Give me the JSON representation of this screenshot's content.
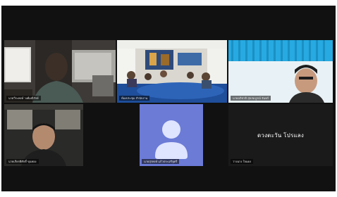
{
  "meeting": {
    "participants": [
      {
        "id": "p1",
        "name": "นายวีระพงษ์ วงศ์มณีรักษ์",
        "video": "on"
      },
      {
        "id": "p2",
        "name": "ห้องประชุม สำนักงาน",
        "video": "on"
      },
      {
        "id": "p3",
        "name": "นายอภิชาติ สุขสมบูรณ์ จันทร์",
        "video": "on"
      },
      {
        "id": "p4",
        "name": "นายเกียรติศักดิ์ ขุนทอง",
        "video": "on"
      },
      {
        "id": "p5",
        "name": "นายสุรพงษ์ แก้วประเสริฐศรี",
        "video": "off",
        "avatar_icon": "user-avatar-icon"
      },
      {
        "id": "p6",
        "name": "วางนาง ใจแดง",
        "display_name": "ดวงตะวัน โปรแลง",
        "video": "off"
      }
    ]
  },
  "colors": {
    "avatar_bg": "#6b7bd6",
    "avatar_fg": "#dfe4ff"
  }
}
